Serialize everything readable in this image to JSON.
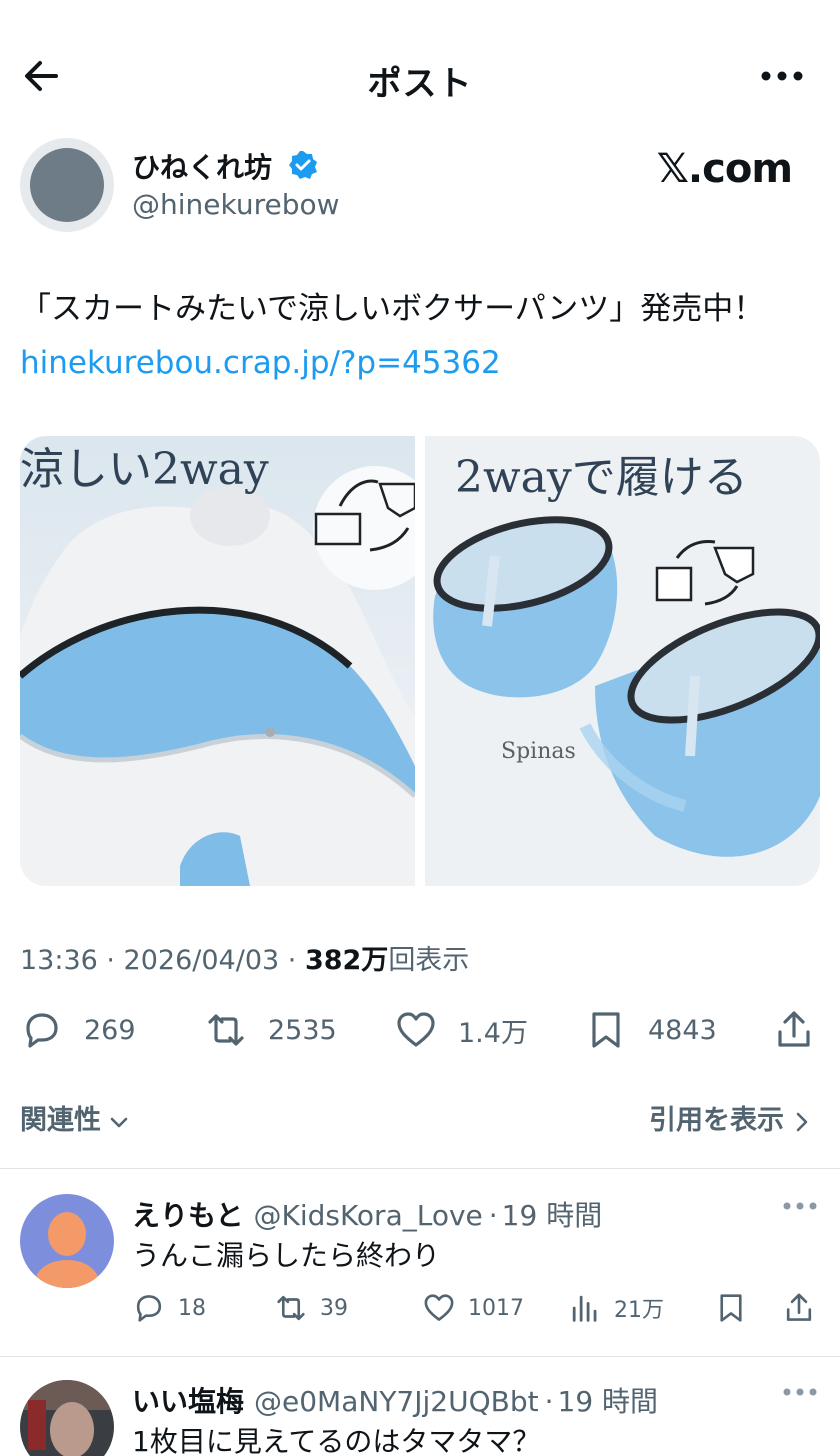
{
  "header": {
    "title": "ポスト",
    "back_icon": "arrow-left-icon",
    "more_icon": "ellipsis-icon"
  },
  "post": {
    "author_name": "ひねくれ坊",
    "author_handle": "@hinekurebow",
    "watermark": "𝕏.com",
    "text_prefix": "「スカートみたいで涼しいボクサーパンツ」発売中！ ",
    "link": "hinekurebou.crap.jp/?p=45362",
    "image_left_caption": "涼しい2way",
    "image_right_caption": "2wayで履ける",
    "image_brand": "Spinas",
    "time": "13:36 · 2026/04/03 · ",
    "views_number": "382万",
    "views_suffix": "回表示",
    "stats": {
      "replies": "269",
      "reposts": "2535",
      "likes": "1.4万",
      "bookmarks": "4843"
    }
  },
  "related_label": "関連性",
  "quotes_label": "引用を表示",
  "replies": [
    {
      "name": "えりもと",
      "handle": "@KidsKora_Love",
      "time": "19 時間",
      "text": "うんこ漏らしたら終わり",
      "replies": "18",
      "reposts": "39",
      "likes": "1017",
      "views": "21万"
    },
    {
      "name": "いい塩梅",
      "handle": "@e0MaNY7Jj2UQBbt",
      "time": "19 時間",
      "text": "1枚目に見えてるのはタマタマ？"
    }
  ],
  "colors": {
    "link": "#1d9bf0",
    "secondary": "#536471",
    "verified": "#1d9bf0"
  }
}
